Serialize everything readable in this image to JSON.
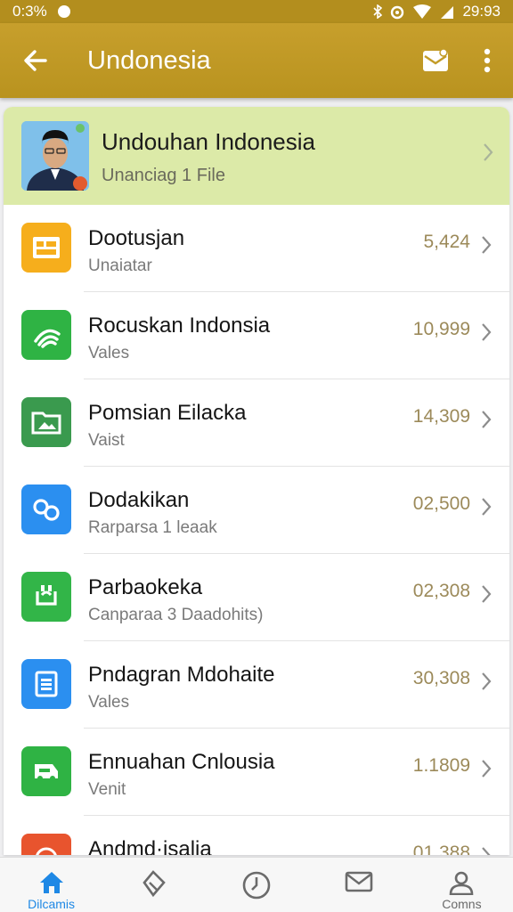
{
  "status_bar": {
    "time_left": "0:3%",
    "time_right": "29:93"
  },
  "header": {
    "title": "Undonesia"
  },
  "banner": {
    "title": "Undouhan Indonesia",
    "subtitle": "Unanciag 1 File"
  },
  "items": [
    {
      "name": "Dootusjan",
      "sub": "Unaiatar",
      "value": "5,424",
      "icon": "calendar-icon",
      "color": "#f6ae1c"
    },
    {
      "name": "Rocuskan Indonsia",
      "sub": "Vales",
      "value": "10,999",
      "icon": "signal-icon",
      "color": "#2fb344"
    },
    {
      "name": "Pomsian Eilacka",
      "sub": "Vaist",
      "value": "14,309",
      "icon": "folder-image-icon",
      "color": "#3a9a4e"
    },
    {
      "name": "Dodakikan",
      "sub": "Rarparsa 1 leaak",
      "value": "02,500",
      "icon": "link-icon",
      "color": "#2b8ff0"
    },
    {
      "name": "Parbaokeka",
      "sub": "Canparaa 3 Daadohits)",
      "value": "02,308",
      "icon": "refresh-icon",
      "color": "#32b548"
    },
    {
      "name": "Pndagran Mdohaite",
      "sub": "Vales",
      "value": "30,308",
      "icon": "document-icon",
      "color": "#2b8ff0"
    },
    {
      "name": "Ennuahan Cnlousia",
      "sub": "Venit",
      "value": "1.1809",
      "icon": "car-icon",
      "color": "#2fb344"
    },
    {
      "name": "Andmd·isalia",
      "sub": "",
      "value": "01,388",
      "icon": "target-icon",
      "color": "#e8542e"
    }
  ],
  "bottom_nav": [
    {
      "label": "Dilcamis",
      "icon": "home-icon",
      "active": true
    },
    {
      "label": "",
      "icon": "tag-icon",
      "active": false
    },
    {
      "label": "",
      "icon": "clock-icon",
      "active": false
    },
    {
      "label": "",
      "icon": "mail-icon",
      "active": false
    },
    {
      "label": "Comns",
      "icon": "user-icon",
      "active": false
    }
  ]
}
